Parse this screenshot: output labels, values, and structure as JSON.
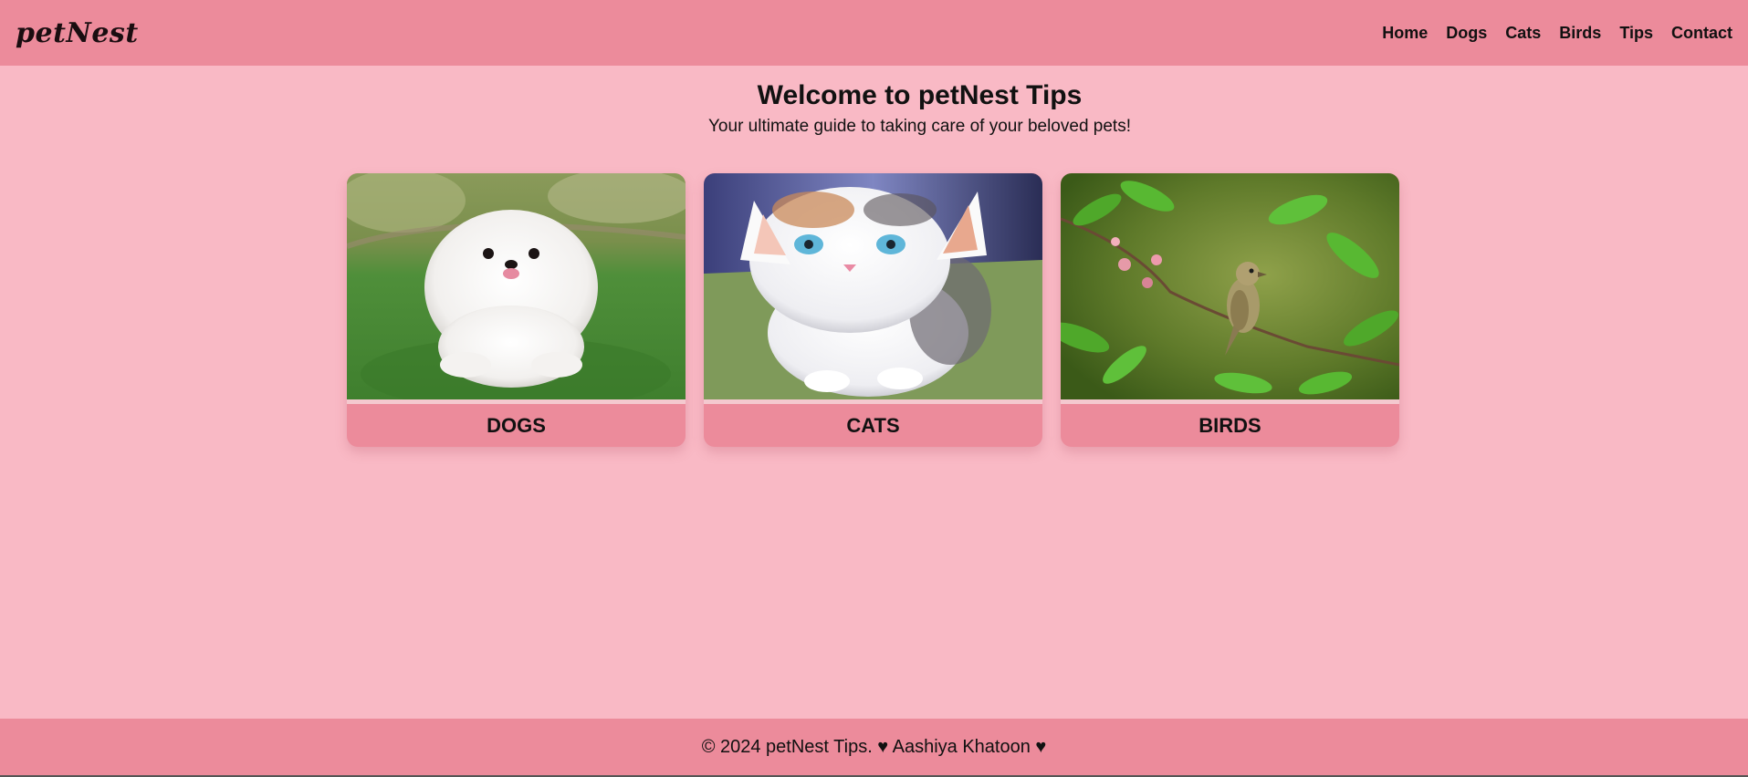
{
  "header": {
    "logo": "petNest",
    "nav": [
      "Home",
      "Dogs",
      "Cats",
      "Birds",
      "Tips",
      "Contact"
    ]
  },
  "hero": {
    "title": "Welcome to petNest Tips",
    "subtitle": "Your ultimate guide to taking care of your beloved pets!"
  },
  "cards": [
    {
      "label": "DOGS",
      "image": "white-pomeranian-puppy-on-grass"
    },
    {
      "label": "CATS",
      "image": "white-kitten-with-blue-eyes"
    },
    {
      "label": "BIRDS",
      "image": "sparrow-on-flowering-branch"
    }
  ],
  "footer": {
    "text": "© 2024 petNest Tips. ♥ Aashiya Khatoon ♥"
  },
  "colors": {
    "background": "#f9b9c5",
    "bars": "#ec8b9b"
  }
}
